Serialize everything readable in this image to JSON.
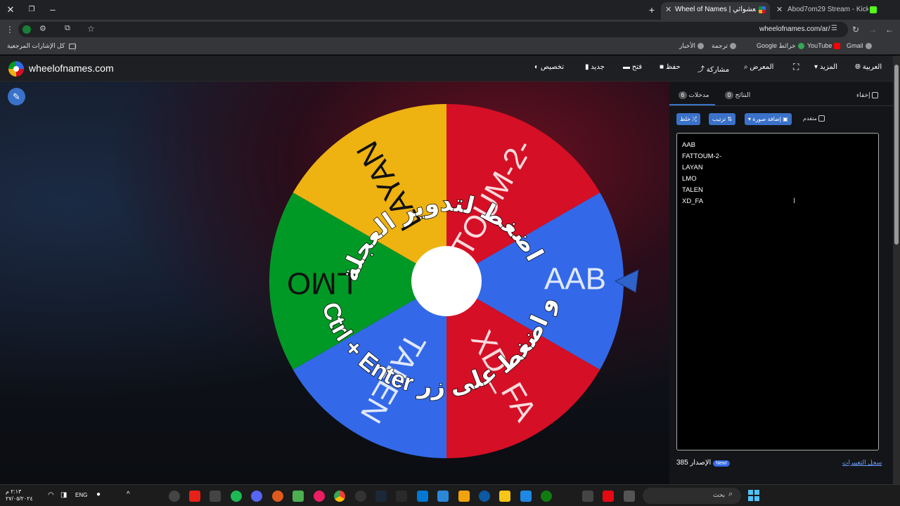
{
  "browser": {
    "tabs": [
      {
        "title": "Wheel of Names | مُسم العشوائي",
        "active": true
      },
      {
        "title": "Abod7om29 Stream - Kick Das",
        "active": false
      }
    ],
    "new_tab": "+",
    "url": "wheelofnames.com/ar/",
    "bookmarks": [
      {
        "label": "Gmail"
      },
      {
        "label": "YouTube"
      },
      {
        "label": "Google خرائط"
      },
      {
        "label": "ترجمة"
      },
      {
        "label": "الأخبار"
      }
    ],
    "all_bookmarks": "كل الإشارات المرجعية"
  },
  "site": {
    "logo_text": "wheelofnames.com",
    "nav": {
      "language": "العربية",
      "more": "المزيد",
      "gallery": "المعرض",
      "share": "مشاركة",
      "save": "حفظ",
      "open": "فتح",
      "new": "جديد",
      "customize": "تخصيص"
    }
  },
  "wheel": {
    "spin_hint_line1": "اضغط لتدوير العجلة",
    "spin_hint_line2": "أو اضغط على زر",
    "spin_hint_keys": "Ctrl + Enter",
    "segments": [
      {
        "label": "AAB",
        "color": "#3369e8"
      },
      {
        "label": "XD_FA",
        "color": "#d50f25"
      },
      {
        "label": "TALEN",
        "color": "#3369e8"
      },
      {
        "label": "LMO",
        "color": "#009925"
      },
      {
        "label": "LAYAN",
        "color": "#eeb211"
      },
      {
        "label": "FATTOUM-2-",
        "color": "#d50f25"
      }
    ]
  },
  "panel": {
    "hide_label": "إخفاء",
    "results_label": "النتائج",
    "results_count": "0",
    "entries_label": "مدخلات",
    "entries_count": "6",
    "advanced_label": "متقدم",
    "add_image_label": "إضافة صورة",
    "sort_label": "ترتيب",
    "shuffle_label": "خلط",
    "entries": [
      "AAB",
      "FATTOUM-2-",
      "LAYAN",
      "LMO",
      "TALEN",
      "XD_FA"
    ],
    "version_label": "الإصدار",
    "version_number": "385",
    "new_badge": "New!",
    "changelog_label": "سجل التغييرات"
  },
  "taskbar": {
    "search_placeholder": "بحث",
    "lang": "ENG",
    "time": "٢:١٣ م",
    "date": "٢٧/٠٥/٢٠٢٤"
  }
}
